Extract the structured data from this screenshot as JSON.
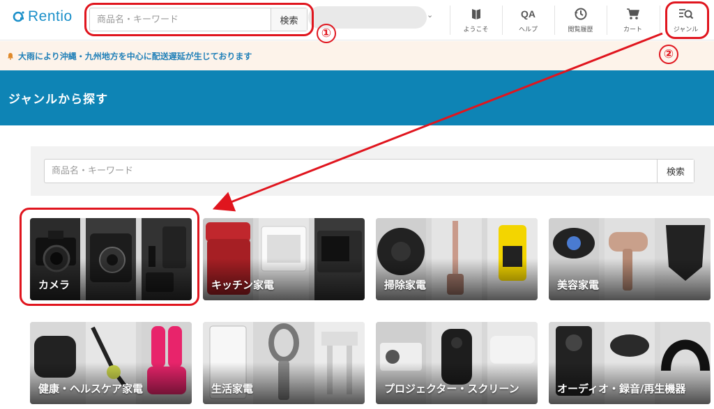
{
  "header": {
    "logo_text": "Rentio",
    "search_placeholder": "商品名・キーワード",
    "search_button": "検索",
    "nav": [
      {
        "label": "ようこそ",
        "icon": "welcome-icon"
      },
      {
        "label": "ヘルプ",
        "icon": "qa-icon"
      },
      {
        "label": "閲覧履歴",
        "icon": "history-icon"
      },
      {
        "label": "カート",
        "icon": "cart-icon"
      },
      {
        "label": "ジャンル",
        "icon": "genre-search-icon"
      }
    ]
  },
  "notice": {
    "text": "大雨により沖縄・九州地方を中心に配送遅延が生じております",
    "icon": "bell-icon"
  },
  "banner": {
    "title": "ジャンルから探す"
  },
  "panel": {
    "search_placeholder": "商品名・キーワード",
    "search_button": "検索"
  },
  "categories": [
    {
      "label": "カメラ"
    },
    {
      "label": "キッチン家電"
    },
    {
      "label": "掃除家電"
    },
    {
      "label": "美容家電"
    },
    {
      "label": "健康・ヘルスケア家電"
    },
    {
      "label": "生活家電"
    },
    {
      "label": "プロジェクター・スクリーン"
    },
    {
      "label": "オーディオ・録音/再生機器"
    }
  ],
  "annotations": {
    "first": "①",
    "second": "②"
  },
  "colors": {
    "brand": "#1a8fc9",
    "banner": "#0e84b5",
    "annotation": "#e0151e",
    "notice_bg": "#fdf3ea"
  }
}
